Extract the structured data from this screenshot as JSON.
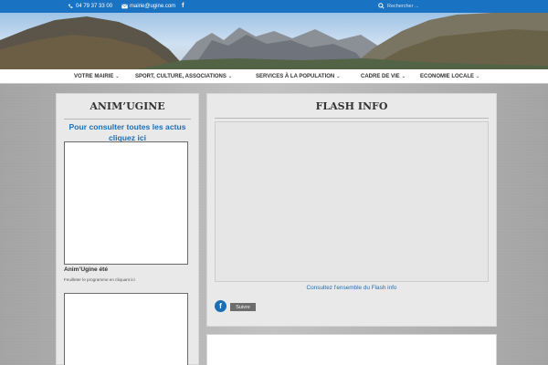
{
  "topbar": {
    "phone": "04 79 37 33 00",
    "email": "mairie@ugine.com",
    "facebook_icon": "facebook-icon",
    "search_placeholder": "Rechercher ..."
  },
  "nav": {
    "items": [
      {
        "label": "VOTRE MAIRIE"
      },
      {
        "label": "SPORT, CULTURE, ASSOCIATIONS"
      },
      {
        "label": "SERVICES À LA POPULATION"
      },
      {
        "label": "CADRE DE VIE"
      },
      {
        "label": "ECONOMIE LOCALE"
      }
    ]
  },
  "left_panel": {
    "title": "ANIM’UGINE",
    "link": "Pour consulter toutes les actus cliquez ici",
    "caption": "Anim’Ugine été",
    "subcaption": "Feuilleter le programme en cliquant ici"
  },
  "right_panel": {
    "title": "FLASH INFO",
    "link": "Consultez l'ensemble du Flash info",
    "facebook_letter": "f",
    "follow_label": "Suivre"
  },
  "colors": {
    "topbar": "#1a72c2",
    "link": "#1f6eb3",
    "follow_button": "#6d6d6d"
  }
}
